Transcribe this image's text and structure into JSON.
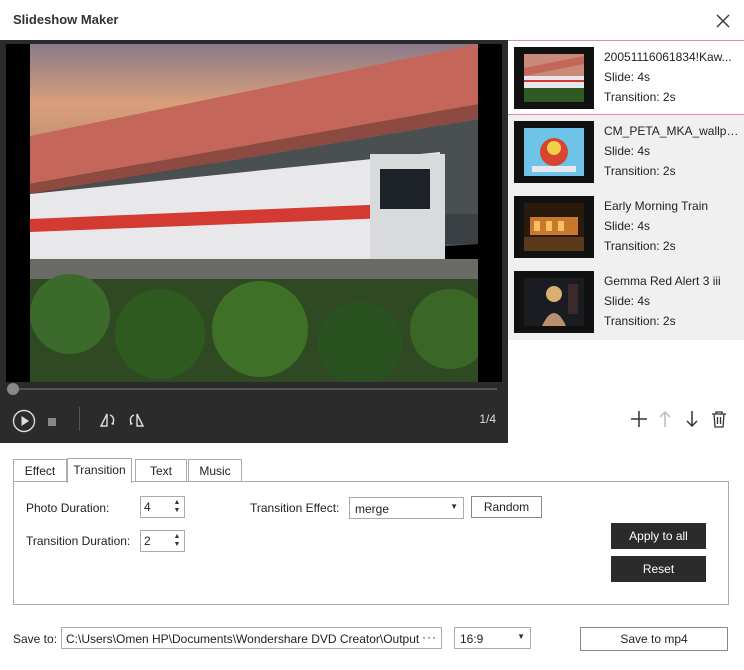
{
  "window": {
    "title": "Slideshow Maker"
  },
  "player": {
    "counter": "1/4"
  },
  "slides": [
    {
      "name": "20051116061834!Kaw...",
      "slide": "Slide: 4s",
      "transition": "Transition: 2s"
    },
    {
      "name": "CM_PETA_MKA_wallpa...",
      "slide": "Slide: 4s",
      "transition": "Transition: 2s"
    },
    {
      "name": "Early Morning Train",
      "slide": "Slide: 4s",
      "transition": "Transition: 2s"
    },
    {
      "name": "Gemma Red Alert 3 iii",
      "slide": "Slide: 4s",
      "transition": "Transition: 2s"
    }
  ],
  "tabs": [
    "Effect",
    "Transition",
    "Text",
    "Music"
  ],
  "settings": {
    "photo_duration_label": "Photo Duration:",
    "photo_duration_value": "4",
    "transition_duration_label": "Transition Duration:",
    "transition_duration_value": "2",
    "transition_effect_label": "Transition Effect:",
    "transition_effect_value": "merge",
    "random_label": "Random",
    "apply_all_label": "Apply to all",
    "reset_label": "Reset"
  },
  "footer": {
    "save_to_label": "Save to:",
    "path": "C:\\Users\\Omen HP\\Documents\\Wondershare DVD Creator\\Output",
    "browse": "···",
    "aspect": "16:9",
    "save_button": "Save to mp4"
  },
  "colors": {
    "selected_border": "#e98a9a",
    "dark_button": "#2b2b2b",
    "preview_bg": "#2b2b2b"
  }
}
